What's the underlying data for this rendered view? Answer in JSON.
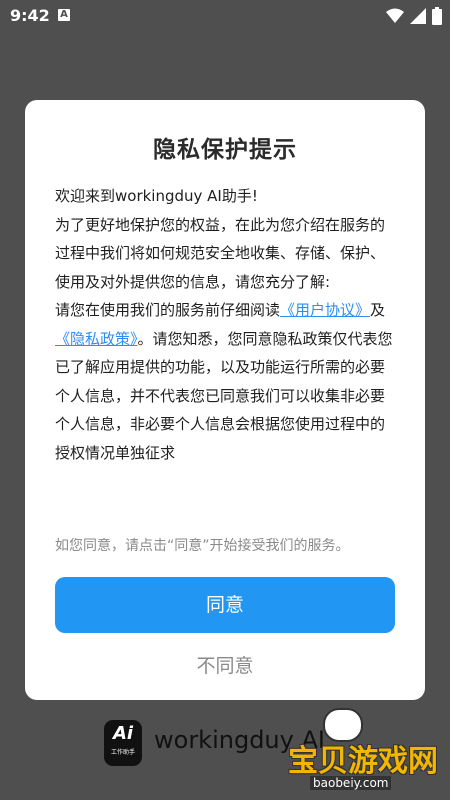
{
  "status_bar": {
    "time": "9:42",
    "notification_icon": "A"
  },
  "dialog": {
    "title": "隐私保护提示",
    "greeting": "欢迎来到workingduy AI助手!",
    "paragraph1": "为了更好地保护您的权益，在此为您介绍在服务的过程中我们将如何规范安全地收集、存储、保护、使用及对外提供您的信息，请您充分了解:",
    "paragraph2_start": "请您在使用我们的服务前仔细阅读",
    "user_agreement_link": "《用户协议》",
    "and_text": "及",
    "privacy_policy_link": "《隐私政策》",
    "paragraph2_rest": "。请您知悉，您同意隐私政策仅代表您已了解应用提供的功能，以及功能运行所需的必要个人信息，并不代表您已同意我们可以收集非必要个人信息，非必要个人信息会根据您使用过程中的授权情况单独征求",
    "hint": "如您同意，请点击“同意”开始接受我们的服务。",
    "agree_label": "同意",
    "disagree_label": "不同意"
  },
  "background_brand": {
    "logo_text": "Ai",
    "logo_subtext": "工作助手",
    "app_name": "workingduy AI"
  },
  "watermark": {
    "text": "宝贝游戏网",
    "url": "baobeiy.com"
  },
  "colors": {
    "accent": "#2196f3",
    "link": "#2f8cf4",
    "overlay": "#4f4f4f",
    "hint": "#8a8a8a"
  }
}
